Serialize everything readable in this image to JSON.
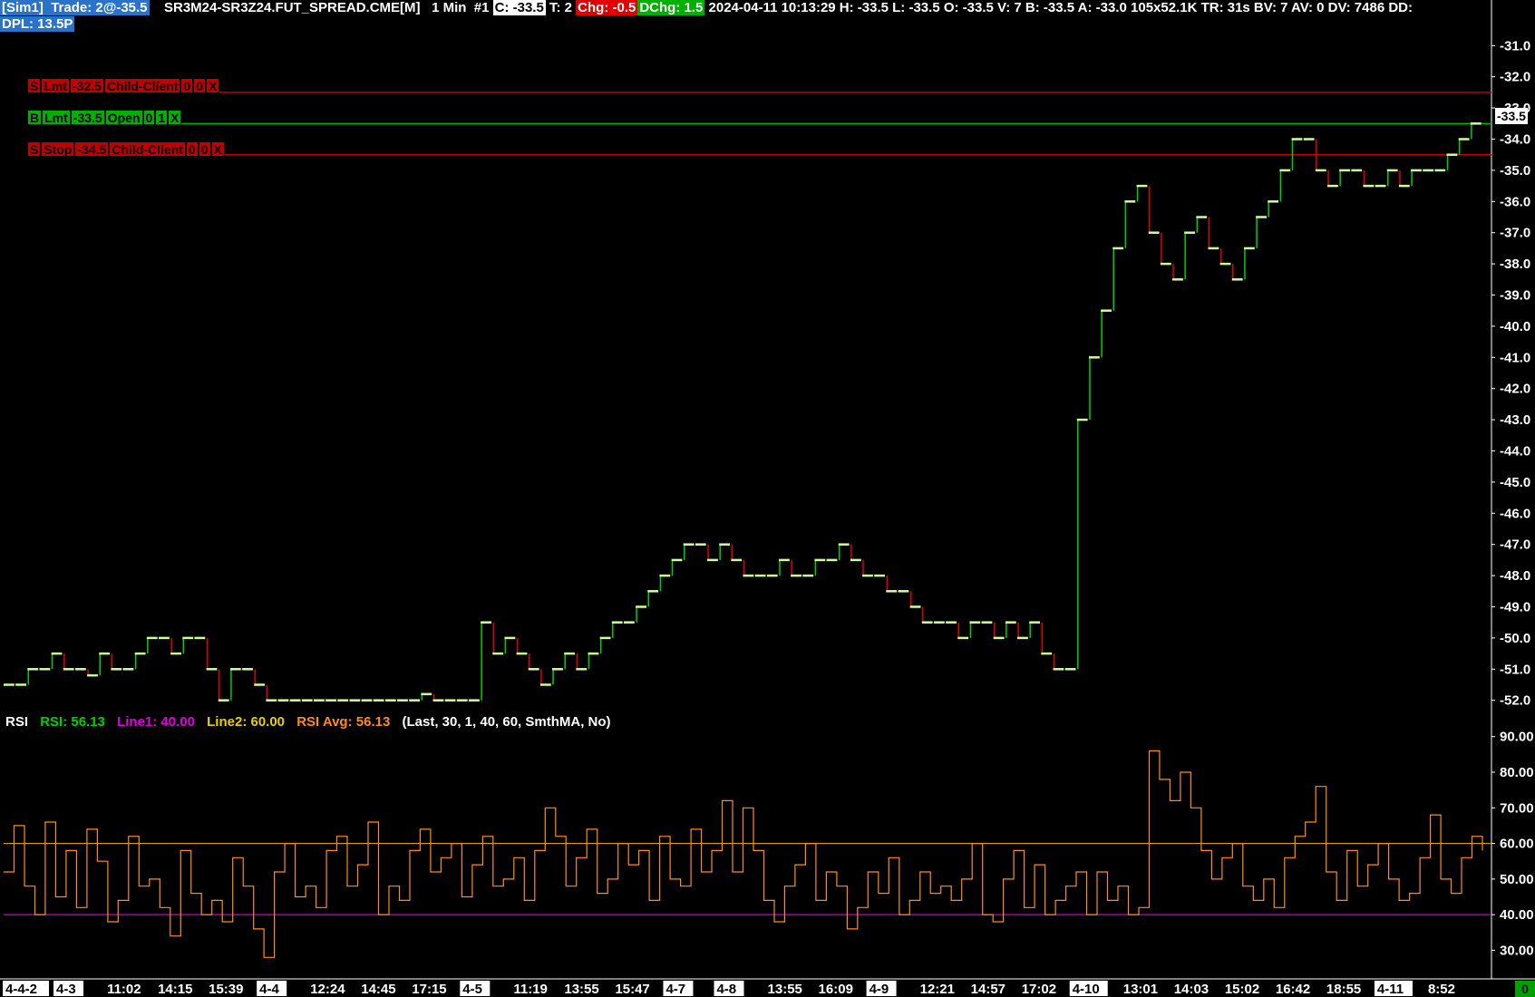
{
  "header": {
    "sim": "[Sim1]",
    "trade": "Trade: 2@-35.5",
    "symbol": "SR3M24-SR3Z24.FUT_SPREAD.CME[M]",
    "interval": "1 Min",
    "chart_num": "#1",
    "close": "C: -33.5",
    "ticks": "T: 2",
    "chg": "Chg: -0.5",
    "dchg": "DChg: 1.5",
    "stats": "2024-04-11 10:13:29 H: -33.5 L: -33.5 O: -33.5 V: 7 B: -33.5 A: -33.0 105x52.1K TR: 31s BV: 7 AV: 0 DV: 7486 DD:",
    "dpl": "DPL: 13.5P"
  },
  "orders": [
    {
      "parts": [
        "S",
        "Lmt",
        "-32.5",
        "Child-Client",
        "0",
        "0",
        "X"
      ],
      "side": "sell",
      "price": -32.5
    },
    {
      "parts": [
        "B",
        "Lmt",
        "-33.5",
        "Open",
        "0",
        "1",
        "X"
      ],
      "side": "buy",
      "price": -33.5
    },
    {
      "parts": [
        "S",
        "Stop",
        "-34.5",
        "Child-Client",
        "0",
        "0",
        "X"
      ],
      "side": "sell",
      "price": -34.5
    }
  ],
  "current_price_label": "-33.5",
  "indicator": {
    "name": "RSI",
    "rsi": "RSI: 56.13",
    "line1": "Line1: 40.00",
    "line2": "Line2: 60.00",
    "rsi_avg": "RSI Avg: 56.13",
    "params": "(Last, 30, 1, 40, 60, SmthMA, No)"
  },
  "corner_value": "0",
  "colors": {
    "background": "#000000",
    "up_bar": "#00d000",
    "down_bar": "#e00000",
    "flat_bar": "#ccff99",
    "rsi": "#ff8c1a",
    "line1": "#cc00cc",
    "line2": "#d4a000",
    "sell_order": "#c00000",
    "buy_order": "#00b000"
  },
  "chart_data": [
    {
      "type": "line",
      "title": "SR3M24-SR3Z24.FUT_SPREAD.CME[M] 1 Min",
      "y_ticks": [
        "-31.0",
        "-32.0",
        "-33.0",
        "-34.0",
        "-35.0",
        "-36.0",
        "-37.0",
        "-38.0",
        "-39.0",
        "-40.0",
        "-41.0",
        "-42.0",
        "-43.0",
        "-44.0",
        "-45.0",
        "-46.0",
        "-47.0",
        "-48.0",
        "-49.0",
        "-50.0",
        "-51.0",
        "-52.0"
      ],
      "ylim": [
        -52.3,
        -30.7
      ],
      "x_tick_labels": [
        {
          "label": "4-4-2",
          "boxed": true
        },
        {
          "label": "4-3",
          "boxed": true
        },
        {
          "label": "11:02"
        },
        {
          "label": "14:15"
        },
        {
          "label": "15:39"
        },
        {
          "label": "4-4",
          "boxed": true
        },
        {
          "label": "12:24"
        },
        {
          "label": "14:45"
        },
        {
          "label": "17:15"
        },
        {
          "label": "4-5",
          "boxed": true
        },
        {
          "label": "11:19"
        },
        {
          "label": "13:55"
        },
        {
          "label": "15:47"
        },
        {
          "label": "4-7",
          "boxed": true
        },
        {
          "label": "4-8",
          "boxed": true
        },
        {
          "label": "13:55"
        },
        {
          "label": "16:09"
        },
        {
          "label": "4-9",
          "boxed": true
        },
        {
          "label": "12:21"
        },
        {
          "label": "14:57"
        },
        {
          "label": "17:02"
        },
        {
          "label": "4-10",
          "boxed": true
        },
        {
          "label": "13:01"
        },
        {
          "label": "14:03"
        },
        {
          "label": "15:02"
        },
        {
          "label": "16:42"
        },
        {
          "label": "18:55"
        },
        {
          "label": "4-11",
          "boxed": true
        },
        {
          "label": "8:52"
        }
      ],
      "series": [
        {
          "values": [
            -51.5,
            -51.5,
            -51.0,
            -51.0,
            -50.5,
            -51.0,
            -51.0,
            -51.2,
            -50.5,
            -51.0,
            -51.0,
            -50.5,
            -50.0,
            -50.0,
            -50.5,
            -50.0,
            -50.0,
            -51.0,
            -52.0,
            -51.0,
            -51.0,
            -51.5,
            -52.0,
            -52.0,
            -52.0,
            -52.0,
            -52.0,
            -52.0,
            -52.0,
            -52.0,
            -52.0,
            -52.0,
            -52.0,
            -52.0,
            -52.0,
            -51.8,
            -52.0,
            -52.0,
            -52.0,
            -52.0,
            -49.5,
            -50.5,
            -50.0,
            -50.5,
            -51.0,
            -51.5,
            -51.0,
            -50.5,
            -51.0,
            -50.5,
            -50.0,
            -49.5,
            -49.5,
            -49.0,
            -48.5,
            -48.0,
            -47.5,
            -47.0,
            -47.0,
            -47.5,
            -47.0,
            -47.5,
            -48.0,
            -48.0,
            -48.0,
            -47.5,
            -48.0,
            -48.0,
            -47.5,
            -47.5,
            -47.0,
            -47.5,
            -48.0,
            -48.0,
            -48.5,
            -48.5,
            -49.0,
            -49.5,
            -49.5,
            -49.5,
            -50.0,
            -49.5,
            -49.5,
            -50.0,
            -49.5,
            -50.0,
            -49.5,
            -50.5,
            -51.0,
            -51.0,
            -43.0,
            -41.0,
            -39.5,
            -37.5,
            -36.0,
            -35.5,
            -37.0,
            -38.0,
            -38.5,
            -37.0,
            -36.5,
            -37.5,
            -38.0,
            -38.5,
            -37.5,
            -36.5,
            -36.0,
            -35.0,
            -34.0,
            -34.0,
            -35.0,
            -35.5,
            -35.0,
            -35.0,
            -35.5,
            -35.5,
            -35.0,
            -35.5,
            -35.0,
            -35.0,
            -35.0,
            -34.5,
            -34.0,
            -33.5
          ]
        }
      ]
    },
    {
      "type": "line",
      "title": "RSI",
      "y_ticks": [
        "30.00",
        "40.00",
        "50.00",
        "60.00",
        "70.00",
        "80.00",
        "90.00"
      ],
      "ylim": [
        24,
        94
      ],
      "hlines": [
        {
          "name": "Line1",
          "value": 40
        },
        {
          "name": "Line2",
          "value": 60
        }
      ],
      "series": [
        {
          "name": "RSI",
          "values": [
            52,
            65,
            48,
            40,
            66,
            45,
            58,
            42,
            64,
            55,
            38,
            44,
            62,
            48,
            50,
            42,
            34,
            58,
            46,
            40,
            44,
            38,
            56,
            48,
            36,
            28,
            52,
            60,
            45,
            48,
            42,
            58,
            62,
            48,
            54,
            66,
            40,
            48,
            44,
            58,
            64,
            52,
            56,
            60,
            45,
            54,
            62,
            48,
            50,
            56,
            44,
            58,
            70,
            62,
            48,
            56,
            64,
            46,
            50,
            60,
            54,
            58,
            44,
            62,
            50,
            48,
            64,
            52,
            58,
            72,
            52,
            70,
            58,
            44,
            38,
            48,
            54,
            60,
            44,
            52,
            48,
            36,
            42,
            52,
            46,
            56,
            40,
            44,
            52,
            46,
            48,
            44,
            50,
            60,
            40,
            38,
            50,
            58,
            42,
            54,
            40,
            44,
            48,
            52,
            40,
            52,
            44,
            48,
            40,
            42,
            86,
            78,
            72,
            80,
            70,
            58,
            50,
            56,
            60,
            48,
            44,
            50,
            42,
            56,
            62,
            66,
            76,
            52,
            44,
            58,
            48,
            54,
            60,
            50,
            44,
            46,
            56,
            68,
            50,
            46,
            56,
            62,
            58
          ]
        }
      ]
    }
  ]
}
